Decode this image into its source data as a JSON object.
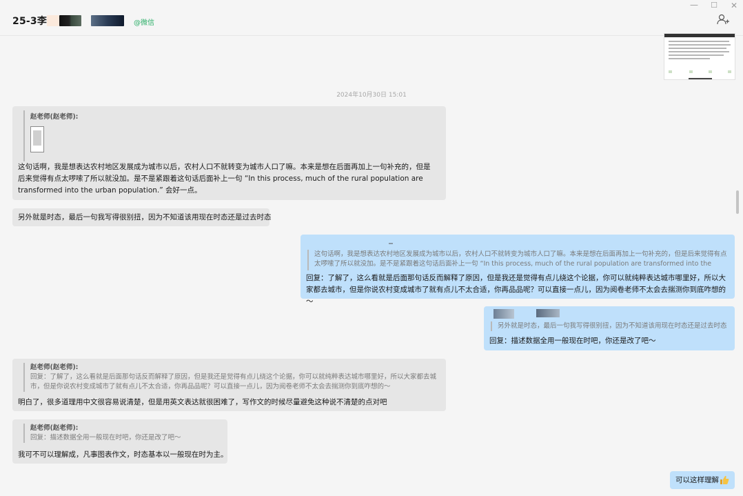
{
  "header": {
    "title": "25-3李,",
    "tag": "@微信"
  },
  "timestamp": "2024年10月30日 15:01",
  "messages": {
    "m1": {
      "quote_author": "赵老师(赵老师):",
      "text": "这句话啊，我是想表达农村地区发展成为城市以后，农村人口不就转变为城市人口了嘛。本来是想在后面再加上一句补充的，但是后来觉得有点太啰嗦了所以就没加。是不是紧跟着这句话后面补上一句 “In this process, much of the rural population are transformed into the urban population.” 会好一点。"
    },
    "m2": {
      "text": "另外就是时态，最后一句我写得很别扭，因为不知道该用现在时态还是过去时态"
    },
    "m3": {
      "quote_text": "这句话啊，我是想表达农村地区发展成为城市以后，农村人口不就转变为城市人口了嘛。本来是想在后面再加上一句补充的，但是后来觉得有点太啰嗦了所以就没加。是不是紧跟着这句话后面补上一句 “In this process, much of the rural population are transformed into the urban...",
      "text": "回复：了解了，这么看就是后面那句话反而解释了原因，但是我还是觉得有点儿绕这个论据，你可以就纯粹表达城市哪里好，所以大家都去城市，但是你说农村变成城市了就有点儿不太合适，你再品品呢？可以直接一点儿，因为阅卷老师不太会去揣测你到底咋想的～"
    },
    "m4": {
      "quote_text": "另外就是时态，最后一句我写得很别扭，因为不知道该用现在时态还是过去时态",
      "text": "回复：描述数据全用一般现在时吧，你还是改了吧～"
    },
    "m5": {
      "quote_author": "赵老师(赵老师):",
      "quote_text": "回复：了解了，这么看就是后面那句话反而解释了原因，但是我还是觉得有点儿绕这个论据，你可以就纯粹表达城市哪里好，所以大家都去城市，但是你说农村变成城市了就有点儿不太合适，你再品品呢？可以直接一点儿，因为阅卷老师不太会去揣测你到底咋想的～",
      "text": "明白了，很多道理用中文很容易说清楚，但是用英文表达就很困难了，写作文的时候尽量避免这种说不清楚的点对吧"
    },
    "m6": {
      "quote_author": "赵老师(赵老师):",
      "quote_text": "回复：描述数据全用一般现在时吧，你还是改了吧～",
      "text": "我可不可以理解成，凡事图表作文，时态基本以一般现在时为主。"
    },
    "m7": {
      "text": "可以这样理解"
    }
  },
  "colors": {
    "bubble_incoming": "#e6e6e6",
    "bubble_outgoing": "#bfe0fb",
    "wechat_green": "#2aae67"
  }
}
